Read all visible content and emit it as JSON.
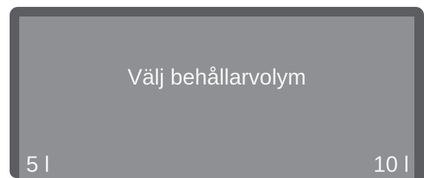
{
  "display": {
    "prompt": "Välj behållarvolym",
    "left_option": "5 l",
    "right_option": "10 l"
  },
  "colors": {
    "frame": "#5c5d60",
    "screen": "#8f9093",
    "text": "#f4f4f4"
  }
}
